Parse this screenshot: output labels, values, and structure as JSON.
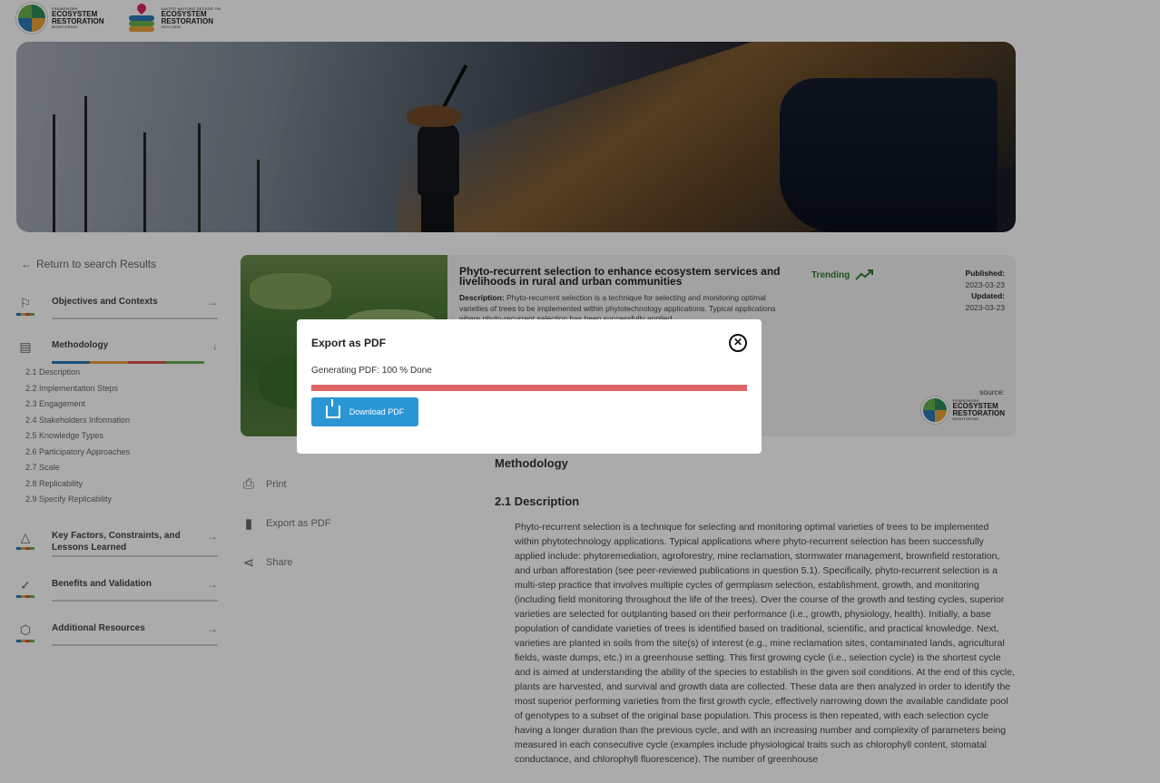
{
  "header": {
    "logo1": {
      "small": "FRAMEWORK",
      "line1": "ECOSYSTEM",
      "line2": "RESTORATION",
      "line3": "MONITORING"
    },
    "logo2": {
      "small": "UNITED NATIONS DECADE ON",
      "line1": "ECOSYSTEM",
      "line2": "RESTORATION",
      "line3": "2021-2030"
    }
  },
  "sidebar": {
    "return_label": "Return to search Results",
    "sections": [
      {
        "label": "Objectives and Contexts",
        "icon": "flag-icon"
      },
      {
        "label": "Methodology",
        "icon": "list-icon"
      },
      {
        "label": "Key Factors, Constraints, and Lessons Learned",
        "icon": "shapes-icon"
      },
      {
        "label": "Benefits and Validation",
        "icon": "hand-check-icon"
      },
      {
        "label": "Additional Resources",
        "icon": "cube-icon"
      }
    ],
    "methodology_items": [
      "2.1 Description",
      "2.2 Implementation Steps",
      "2.3 Engagement",
      "2.4 Stakeholders Information",
      "2.5 Knowledge Types",
      "2.6 Participatory Approaches",
      "2.7 Scale",
      "2.8 Replicability",
      "2.9 Specify Replicability"
    ],
    "bar_colors": [
      "#2a7ab8",
      "#e8a33a",
      "#d9534f",
      "#6ab04c"
    ]
  },
  "card": {
    "title": "Phyto-recurrent selection to enhance ecosystem services and livelihoods in rural and urban communities",
    "description_label": "Description:",
    "description": "Phyto-recurrent selection is a technique for selecting and monitoring optimal varieties of trees to be implemented within phytotechnology applications. Typical applications where phyto-recurrent selection has been successfully applied...",
    "trending": "Trending",
    "published_label": "Published:",
    "published": "2023-03-23",
    "updated_label": "Updated:",
    "updated": "2023-03-23",
    "source_label": "source:",
    "source_logo": {
      "small": "FRAMEWORK",
      "line1": "ECOSYSTEM",
      "line2": "RESTORATION",
      "line3": "MONITORING"
    }
  },
  "actions": {
    "print": "Print",
    "export": "Export as PDF",
    "share": "Share"
  },
  "content": {
    "section_title": "Methodology",
    "subsection_title": "2.1 Description",
    "paragraph": "Phyto-recurrent selection is a technique for selecting and monitoring optimal varieties of trees to be implemented within phytotechnology applications. Typical applications where phyto-recurrent selection has been successfully applied include: phytoremediation, agroforestry, mine reclamation, stormwater management, brownfield restoration, and urban afforestation (see peer-reviewed publications in question 5.1). Specifically, phyto-recurrent selection is a multi-step practice that involves multiple cycles of germplasm selection, establishment, growth, and monitoring (including field monitoring throughout the life of the trees). Over the course of the growth and testing cycles, superior varieties are selected for outplanting based on their performance (i.e., growth, physiology, health). Initially, a base population of candidate varieties of trees is identified based on traditional, scientific, and practical knowledge. Next, varieties are planted in soils from the site(s) of interest (e.g., mine reclamation sites, contaminated lands, agricultural fields, waste dumps, etc.) in a greenhouse setting. This first growing cycle (i.e., selection cycle) is the shortest cycle and is aimed at understanding the ability of the species to establish in the given soil conditions. At the end of this cycle, plants are harvested, and survival and growth data are collected. These data are then analyzed in order to identify the most superior performing varieties from the first growth cycle, effectively narrowing down the available candidate pool of genotypes to a subset of the original base population. This process is then repeated, with each selection cycle having a longer duration than the previous cycle, and with an increasing number and complexity of parameters being measured in each consecutive cycle (examples include physiological traits such as chlorophyll content, stomatal conductance, and chlorophyll fluorescence). The number of greenhouse"
  },
  "modal": {
    "title": "Export as PDF",
    "status": "Generating PDF: 100 % Done",
    "progress": 1.0,
    "download_label": "Download PDF",
    "progress_color": "#e06666",
    "button_color": "#2b96d6"
  }
}
